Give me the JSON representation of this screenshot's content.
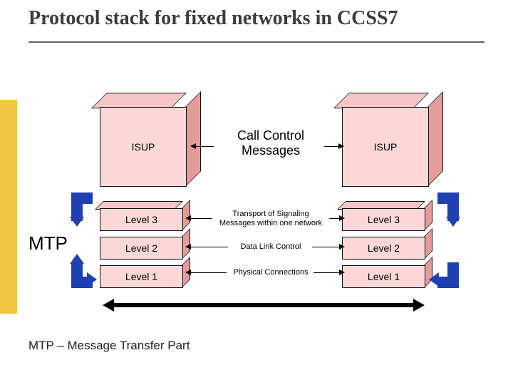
{
  "title": "Protocol stack for fixed networks in CCSS7",
  "mtp_label": "MTP",
  "footer": "MTP – Message Transfer Part",
  "left_stack": {
    "isup": "ISUP",
    "l3": "Level 3",
    "l2": "Level 2",
    "l1": "Level 1"
  },
  "right_stack": {
    "isup": "ISUP",
    "l3": "Level 3",
    "l2": "Level 2",
    "l1": "Level 1"
  },
  "connectors": {
    "call_control_l1": "Call Control",
    "call_control_l2": "Messages",
    "l3_l1": "Transport of Signaling",
    "l3_l2": "Messages within one network",
    "l2": "Data Link Control",
    "l1": "Physical Connections"
  }
}
